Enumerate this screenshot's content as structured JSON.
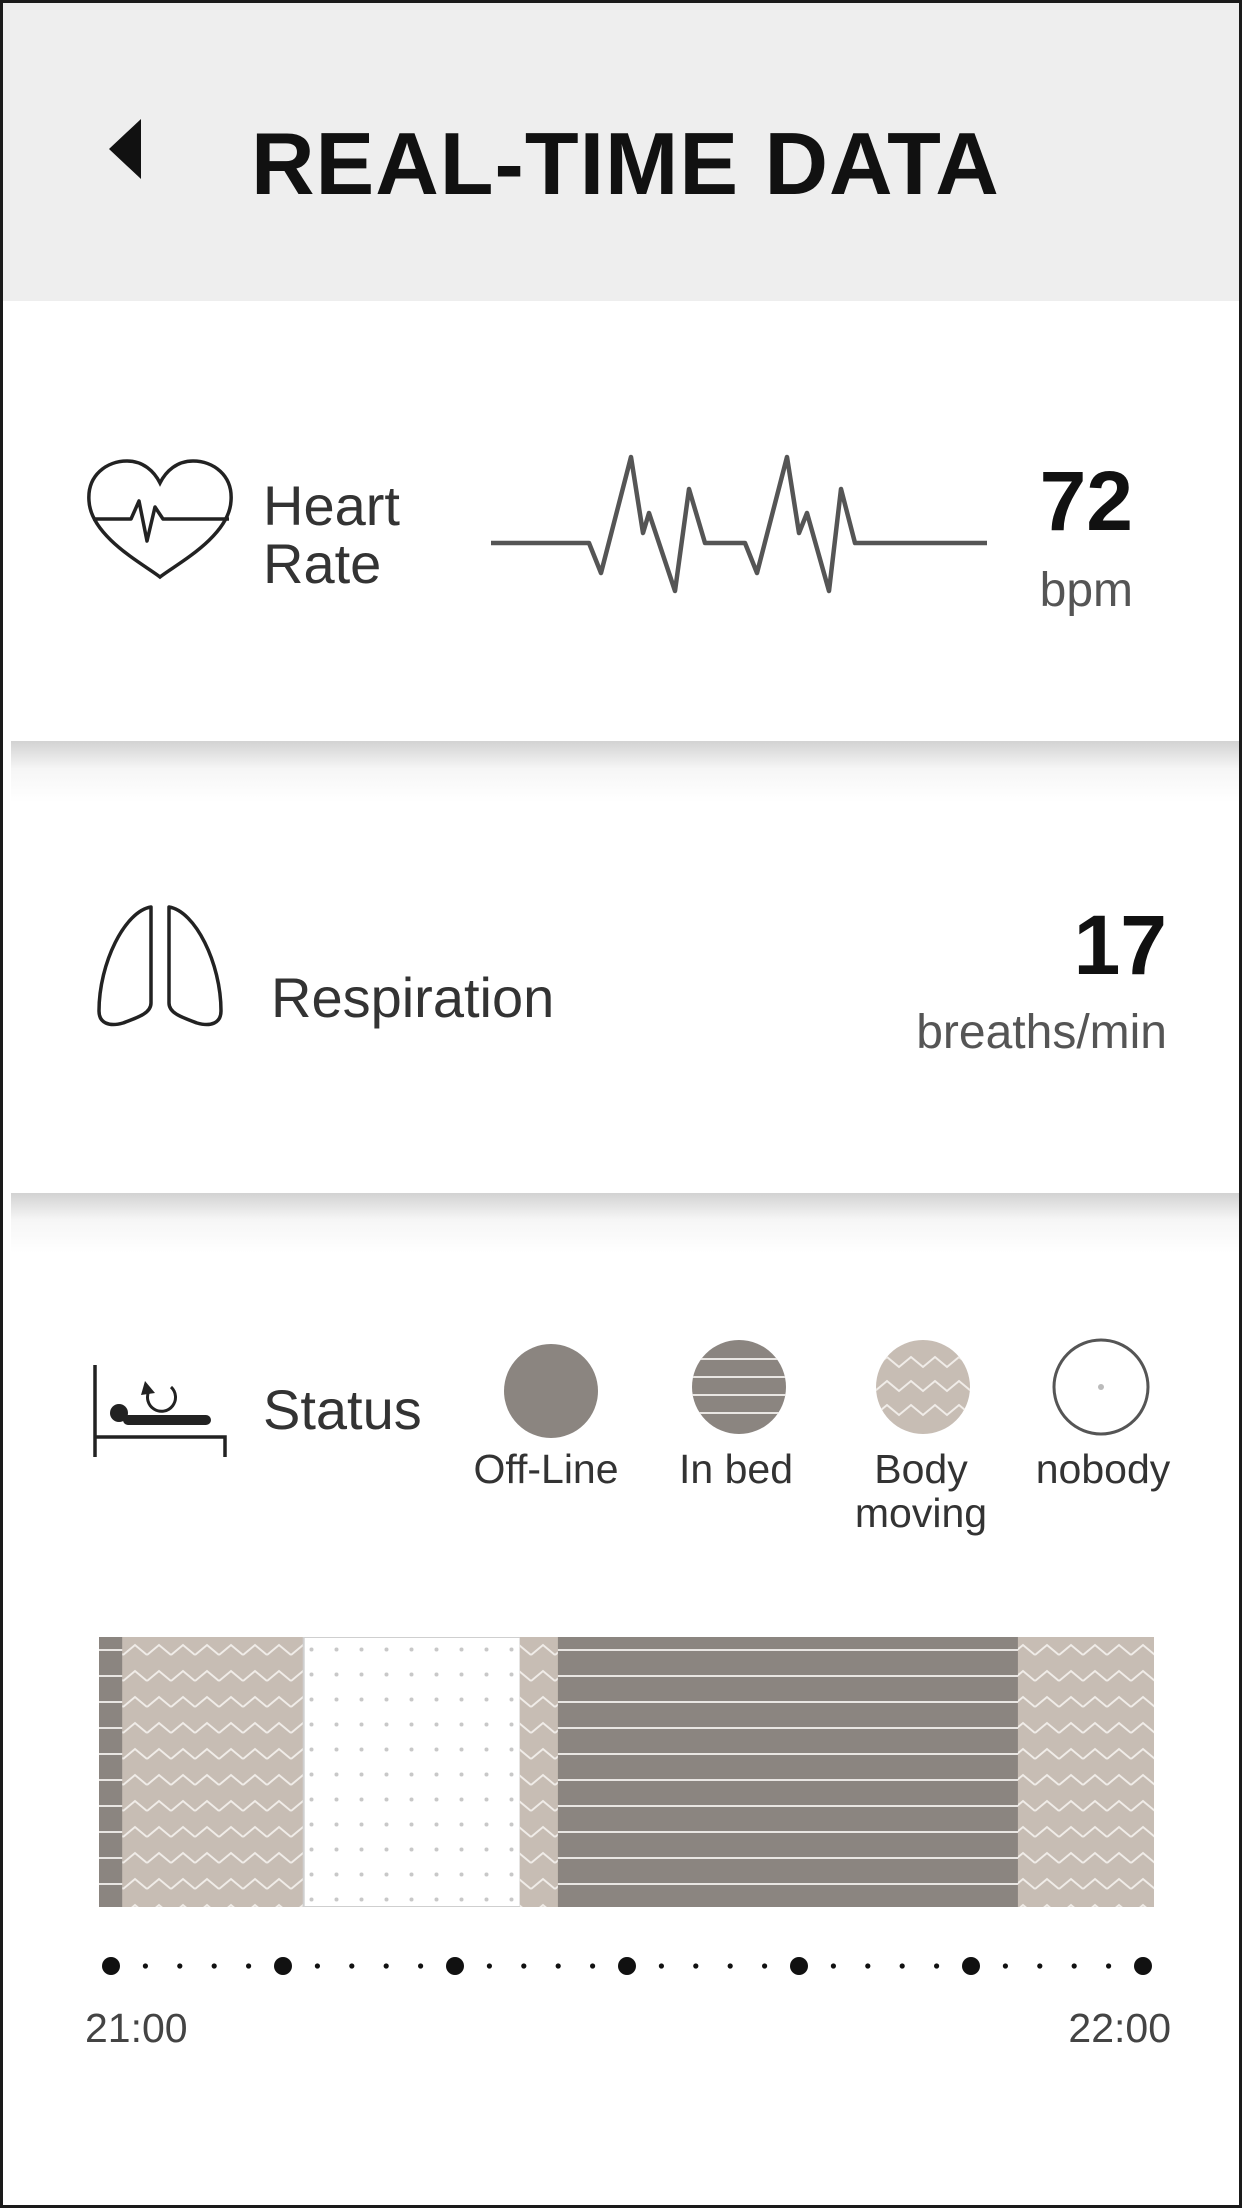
{
  "header": {
    "title": "REAL-TIME DATA",
    "back_icon": "caret-left-icon"
  },
  "heart_rate": {
    "icon": "heart-pulse-icon",
    "label": "Heart\nRate",
    "value": "72",
    "unit": "bpm"
  },
  "respiration": {
    "icon": "lungs-icon",
    "label": "Respiration",
    "value": "17",
    "unit": "breaths/min"
  },
  "status": {
    "icon": "bed-icon",
    "label": "Status",
    "legend": [
      {
        "label": "Off-Line",
        "pattern": "solid"
      },
      {
        "label": "In bed",
        "pattern": "lines"
      },
      {
        "label": "Body\nmoving",
        "pattern": "zigzag"
      },
      {
        "label": "nobody",
        "pattern": "dots"
      }
    ],
    "timeline": {
      "start_label": "21:00",
      "end_label": "22:00",
      "segments": [
        {
          "state": "In bed",
          "fraction": 0.022
        },
        {
          "state": "Body moving",
          "fraction": 0.172
        },
        {
          "state": "nobody",
          "fraction": 0.205
        },
        {
          "state": "Body moving",
          "fraction": 0.036
        },
        {
          "state": "In bed",
          "fraction": 0.436
        },
        {
          "state": "Body moving",
          "fraction": 0.129
        }
      ]
    }
  },
  "colors": {
    "header_bg": "#eeeeee",
    "offline": "#8b8580",
    "in_bed": "#8b8580",
    "body_moving": "#c7bdb4",
    "nobody_dot": "#c8c8c8",
    "text_dark": "#111111"
  }
}
